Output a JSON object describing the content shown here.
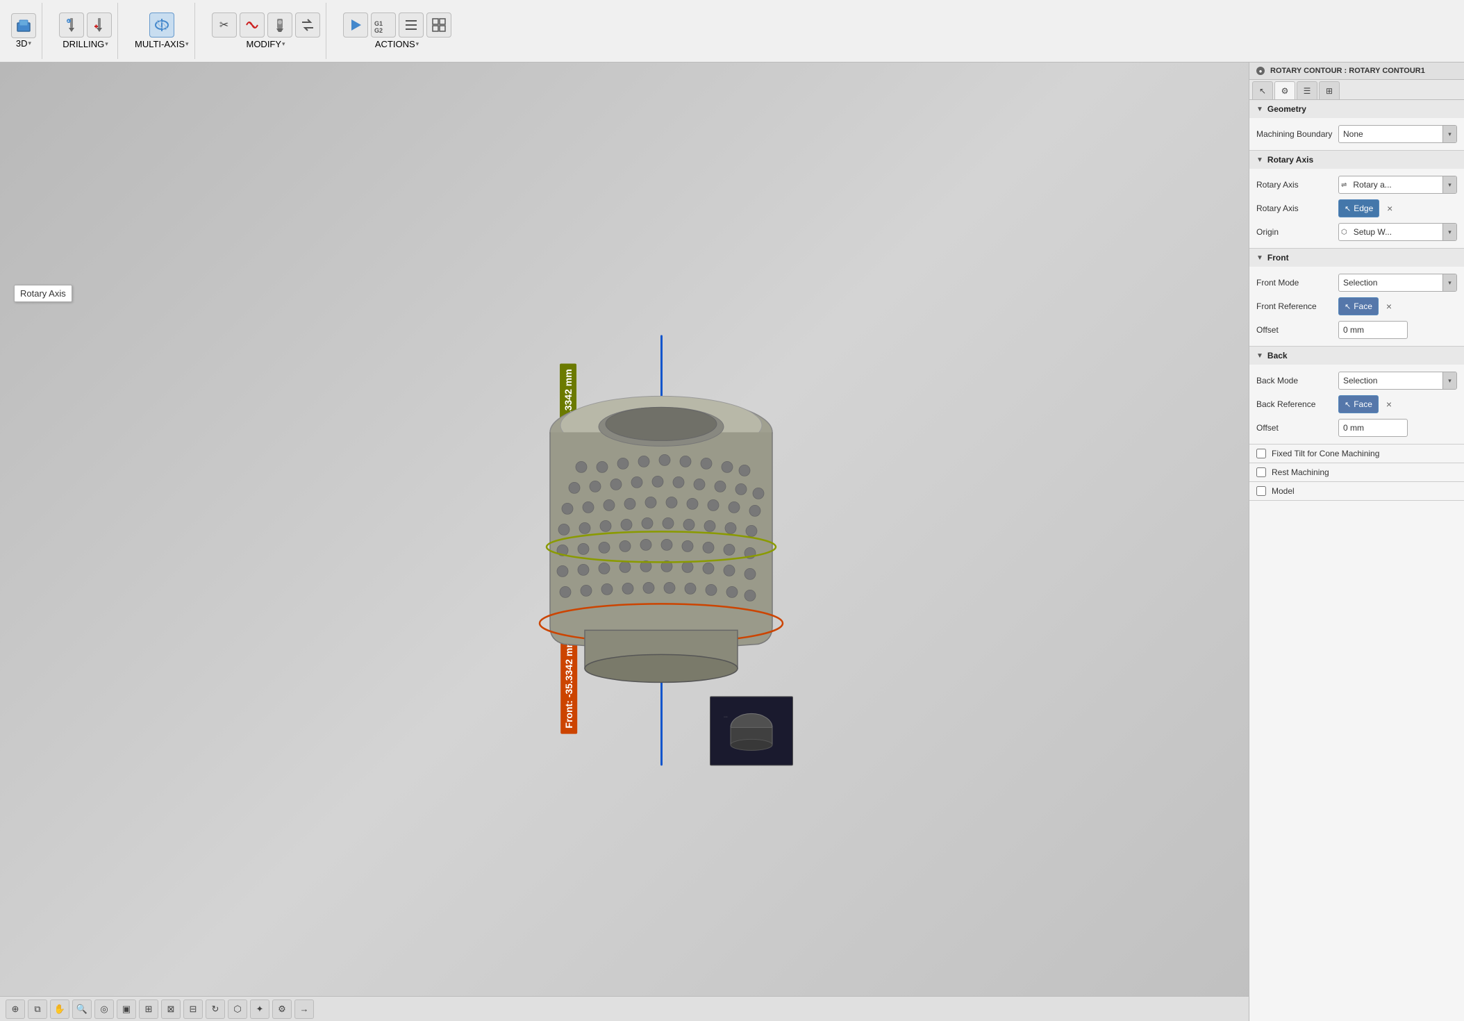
{
  "titlebar": {
    "title": "ROTARY CONTOUR : ROTARY CONTOUR1"
  },
  "toolbar": {
    "groups": [
      {
        "label": "3D",
        "icons": [
          "3d-box",
          "layers",
          "wave",
          "torus"
        ]
      },
      {
        "label": "DRILLING",
        "icons": [
          "drill",
          "drill-add"
        ]
      },
      {
        "label": "MULTI-AXIS",
        "icons": [
          "multi-axis"
        ]
      },
      {
        "label": "MODIFY",
        "icons": [
          "scissors",
          "remove-path",
          "nozzle",
          "swap"
        ]
      },
      {
        "label": "ACTIONS",
        "icons": [
          "play",
          "g1g2",
          "list",
          "grid"
        ]
      }
    ]
  },
  "viewport": {
    "back_label": "Back: -41.3342 mm",
    "front_label": "Front: -35.3342 mm",
    "rotary_axis_tooltip": "Rotary Axis"
  },
  "panel": {
    "title": "ROTARY CONTOUR : ROTARY CONTOUR1",
    "sections": {
      "geometry": {
        "label": "Geometry",
        "machining_boundary_label": "Machining Boundary",
        "machining_boundary_value": "None"
      },
      "rotary_axis": {
        "label": "Rotary Axis",
        "rotary_axis_label": "Rotary Axis",
        "rotary_axis_value": "Rotary a...",
        "rotary_axis_sel_label": "Rotary Axis",
        "rotary_axis_sel_value": "Edge",
        "origin_label": "Origin",
        "origin_value": "Setup W..."
      },
      "front": {
        "label": "Front",
        "front_mode_label": "Front Mode",
        "front_mode_value": "Selection",
        "front_reference_label": "Front Reference",
        "front_reference_value": "Face",
        "offset_label": "Offset",
        "offset_value": "0 mm"
      },
      "back": {
        "label": "Back",
        "back_mode_label": "Back Mode",
        "back_mode_value": "Selection",
        "back_reference_label": "Back Reference",
        "back_reference_value": "Face",
        "offset_label": "Offset",
        "offset_value": "0 mm"
      },
      "fixed_tilt": {
        "label": "Fixed Tilt for Cone Machining",
        "checked": false
      },
      "rest_machining": {
        "label": "Rest Machining",
        "checked": false
      },
      "model": {
        "label": "Model",
        "checked": false
      }
    }
  },
  "status_bar": {
    "tools": [
      "move",
      "navigate",
      "zoom",
      "search",
      "display",
      "measure",
      "filter",
      "points",
      "snap",
      "tools",
      "arrow"
    ]
  },
  "icons": {
    "chevron_right": "▶",
    "chevron_down": "▼",
    "dropdown_arrow": "▾",
    "cursor_icon": "↖",
    "setup_icon": "⬡",
    "close": "×",
    "checkbox_empty": "☐",
    "checkbox_checked": "☑"
  }
}
